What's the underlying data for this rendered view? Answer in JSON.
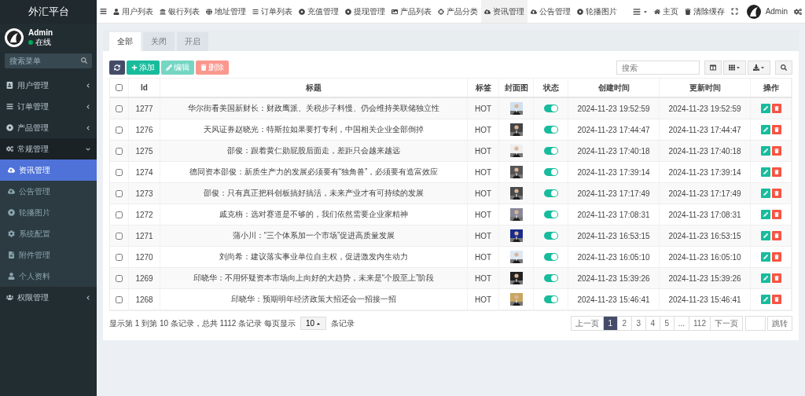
{
  "brand": "外汇平台",
  "topnav": [
    {
      "label": "用户列表",
      "selected": false
    },
    {
      "label": "银行列表",
      "selected": false
    },
    {
      "label": "地址管理",
      "selected": false
    },
    {
      "label": "订单列表",
      "selected": false
    },
    {
      "label": "充值管理",
      "selected": false
    },
    {
      "label": "提现管理",
      "selected": false
    },
    {
      "label": "产品列表",
      "selected": false
    },
    {
      "label": "产品分类",
      "selected": false
    },
    {
      "label": "资讯管理",
      "selected": true
    },
    {
      "label": "公告管理",
      "selected": false
    },
    {
      "label": "轮播图片",
      "selected": false
    }
  ],
  "top_right": [
    {
      "kind": "menu"
    },
    {
      "kind": "home",
      "label": "主页"
    },
    {
      "kind": "cache",
      "label": "清除缓存"
    },
    {
      "kind": "fullscreen"
    },
    {
      "kind": "user",
      "label": "Admin"
    },
    {
      "kind": "settings"
    }
  ],
  "user": {
    "name": "Admin",
    "status": "在线"
  },
  "menu_search": {
    "placeholder": "搜索菜单"
  },
  "sidebar": [
    {
      "label": "用户管理",
      "expanded": false,
      "selected": false
    },
    {
      "label": "订单管理",
      "expanded": false,
      "selected": false
    },
    {
      "label": "产品管理",
      "expanded": false,
      "selected": false
    },
    {
      "label": "常规管理",
      "expanded": true,
      "selected": false,
      "children": [
        {
          "label": "资讯管理",
          "selected": true
        },
        {
          "label": "公告管理",
          "selected": false
        },
        {
          "label": "轮播图片",
          "selected": false
        },
        {
          "label": "系统配置",
          "selected": false
        },
        {
          "label": "附件管理",
          "selected": false
        },
        {
          "label": "个人资料",
          "selected": false
        }
      ]
    },
    {
      "label": "权限管理",
      "expanded": false,
      "selected": false
    }
  ],
  "tabs": [
    {
      "label": "全部",
      "selected": true
    },
    {
      "label": "关闭",
      "selected": false
    },
    {
      "label": "开启",
      "selected": false
    }
  ],
  "actions": [
    {
      "kind": "refresh"
    },
    {
      "kind": "add",
      "label": "添加",
      "disabled": false
    },
    {
      "kind": "edit",
      "label": "编辑",
      "disabled": true
    },
    {
      "kind": "delete",
      "label": "删除",
      "disabled": true
    }
  ],
  "search": {
    "placeholder": "搜索"
  },
  "select_all": {
    "checked": false
  },
  "columns": [
    "Id",
    "标题",
    "标签",
    "封面图",
    "状态",
    "创建时间",
    "更新时间",
    "操作"
  ],
  "rows": [
    {
      "checked": false,
      "id": "1277",
      "title": "华尔街看美国新财长：财政鹰派、关税步子料慢、仍会维持美联储独立性",
      "tag": "HOT",
      "status_on": true,
      "created": "2024-11-23 19:52:59",
      "updated": "2024-11-23 19:52:59"
    },
    {
      "checked": false,
      "id": "1276",
      "title": "天风证券赵晓光：特斯拉如果要打专利，中国相关企业全部倒掉",
      "tag": "HOT",
      "status_on": true,
      "created": "2024-11-23 17:44:47",
      "updated": "2024-11-23 17:44:47"
    },
    {
      "checked": false,
      "id": "1275",
      "title": "邵俊：跟着黄仁勋屁股后面走，差距只会越来越远",
      "tag": "HOT",
      "status_on": true,
      "created": "2024-11-23 17:40:18",
      "updated": "2024-11-23 17:40:18"
    },
    {
      "checked": false,
      "id": "1274",
      "title": "德同资本邵俊：新质生产力的发展必须要有“独角兽”，必须要有造富效应",
      "tag": "HOT",
      "status_on": true,
      "created": "2024-11-23 17:39:14",
      "updated": "2024-11-23 17:39:14"
    },
    {
      "checked": false,
      "id": "1273",
      "title": "邵俊：只有真正把科创板搞好搞活，未来产业才有可持续的发展",
      "tag": "HOT",
      "status_on": true,
      "created": "2024-11-23 17:17:49",
      "updated": "2024-11-23 17:17:49"
    },
    {
      "checked": false,
      "id": "1272",
      "title": "戚克栴：选对赛道是不够的，我们依然需要企业家精神",
      "tag": "HOT",
      "status_on": true,
      "created": "2024-11-23 17:08:31",
      "updated": "2024-11-23 17:08:31"
    },
    {
      "checked": false,
      "id": "1271",
      "title": "蒲小川：“三个体系加一个市场”促进高质量发展",
      "tag": "HOT",
      "status_on": true,
      "created": "2024-11-23 16:53:15",
      "updated": "2024-11-23 16:53:15"
    },
    {
      "checked": false,
      "id": "1270",
      "title": "刘尚希：建议落实事业单位自主权，促进激发内生动力",
      "tag": "HOT",
      "status_on": true,
      "created": "2024-11-23 16:05:10",
      "updated": "2024-11-23 16:05:10"
    },
    {
      "checked": false,
      "id": "1269",
      "title": "邱晓华：不用怀疑资本市场向上向好的大趋势，未来是“个股至上”阶段",
      "tag": "HOT",
      "status_on": true,
      "created": "2024-11-23 15:39:26",
      "updated": "2024-11-23 15:39:26"
    },
    {
      "checked": false,
      "id": "1268",
      "title": "邱晓华：预期明年经济政策大招还会一招接一招",
      "tag": "HOT",
      "status_on": true,
      "created": "2024-11-23 15:46:41",
      "updated": "2024-11-23 15:46:41"
    }
  ],
  "summary": {
    "before": "显示第 1 到第 10 条记录，总共 1112 条记录 每页显示",
    "page_size": "10",
    "after": "条记录"
  },
  "pagination": [
    {
      "label": "上一页",
      "selected": false
    },
    {
      "label": "1",
      "selected": true
    },
    {
      "label": "2",
      "selected": false
    },
    {
      "label": "3",
      "selected": false
    },
    {
      "label": "4",
      "selected": false
    },
    {
      "label": "5",
      "selected": false
    },
    {
      "label": "...",
      "selected": false
    },
    {
      "label": "112",
      "selected": false
    },
    {
      "label": "下一页",
      "selected": false
    }
  ],
  "jump": {
    "label": "跳转"
  }
}
